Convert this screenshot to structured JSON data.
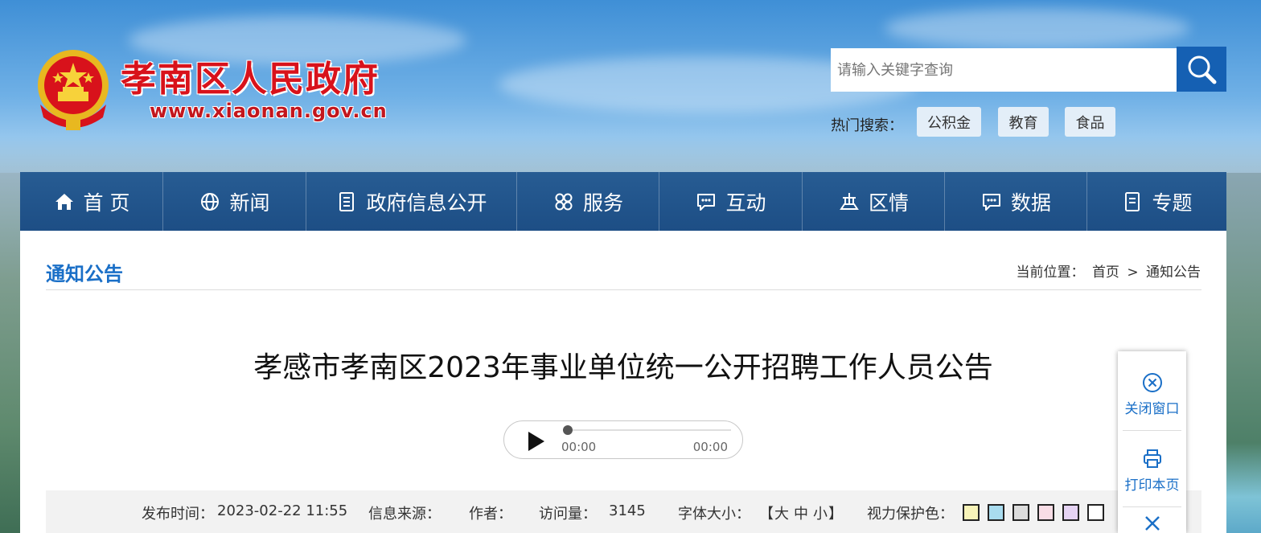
{
  "header": {
    "site_title": "孝南区人民政府",
    "site_url": "www.xiaonan.gov.cn"
  },
  "search": {
    "placeholder": "请输入关键字查询",
    "hot_label": "热门搜索：",
    "hot_tags": [
      "公积金",
      "教育",
      "食品"
    ]
  },
  "nav": {
    "items": [
      {
        "label": "首 页",
        "icon": "home-icon"
      },
      {
        "label": "新闻",
        "icon": "globe-icon"
      },
      {
        "label": "政府信息公开",
        "icon": "document-icon"
      },
      {
        "label": "服务",
        "icon": "grid-icon"
      },
      {
        "label": "互动",
        "icon": "chat-icon"
      },
      {
        "label": "区情",
        "icon": "landmark-icon"
      },
      {
        "label": "数据",
        "icon": "chat-data-icon"
      },
      {
        "label": "专题",
        "icon": "topic-icon"
      }
    ]
  },
  "section": {
    "title": "通知公告",
    "breadcrumb_label": "当前位置：",
    "breadcrumb_home": "首页",
    "breadcrumb_sep": ">",
    "breadcrumb_current": "通知公告"
  },
  "article": {
    "title": "孝感市孝南区2023年事业单位统一公开招聘工作人员公告"
  },
  "audio": {
    "current_time": "00:00",
    "duration": "00:00"
  },
  "meta": {
    "publish_label": "发布时间：",
    "publish_time": "2023-02-22 11:55",
    "source_label": "信息来源：",
    "author_label": "作者：",
    "views_label": "访问量：",
    "views": "3145",
    "font_size_label": "字体大小：",
    "font_open": "【",
    "font_large": "大",
    "font_medium": "中",
    "font_small": "小",
    "font_close": "】",
    "eye_care_label": "视力保护色：",
    "eye_care_colors": [
      "#f7f3b8",
      "#a9dcef",
      "#dcdcdc",
      "#f8dde6",
      "#e6d4f4",
      "#ffffff"
    ]
  },
  "float_panel": {
    "close_label": "关闭窗口",
    "print_label": "打印本页"
  },
  "colors": {
    "brand_red": "#d8121b",
    "nav_blue": "#1d4e85",
    "accent_blue": "#1a6fc7",
    "search_blue": "#1560b3"
  }
}
